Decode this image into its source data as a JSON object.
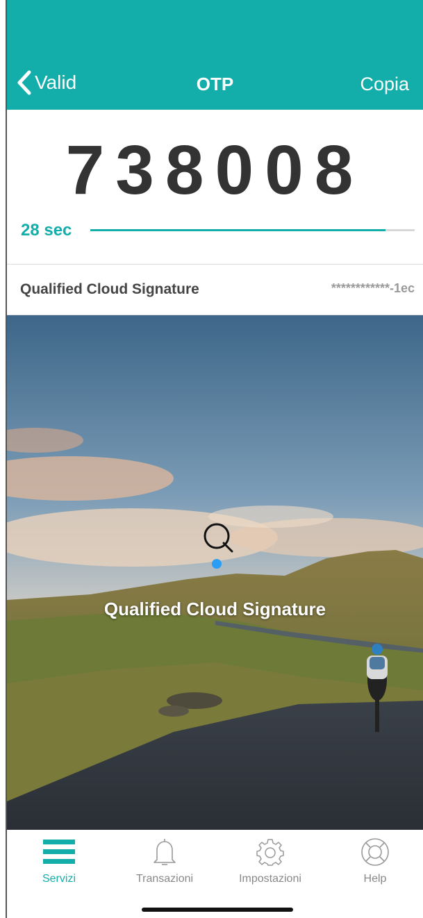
{
  "header": {
    "back_label": "Valid",
    "title": "OTP",
    "copy_label": "Copia"
  },
  "otp": {
    "code": "738008",
    "timer_label": "28 sec",
    "progress": 0.91
  },
  "service": {
    "name": "Qualified Cloud Signature",
    "masked_id": "************-1ec"
  },
  "hero": {
    "logo_letter": "Q",
    "title": "Qualified Cloud Signature"
  },
  "tabbar": {
    "items": [
      {
        "label": "Servizi",
        "icon": "menu-icon",
        "active": true
      },
      {
        "label": "Transazioni",
        "icon": "bell-icon",
        "active": false
      },
      {
        "label": "Impostazioni",
        "icon": "gear-icon",
        "active": false
      },
      {
        "label": "Help",
        "icon": "lifebuoy-icon",
        "active": false
      }
    ]
  },
  "colors": {
    "accent": "#13aeaa",
    "text_dark": "#333333",
    "logo_dot": "#2a9df4"
  }
}
